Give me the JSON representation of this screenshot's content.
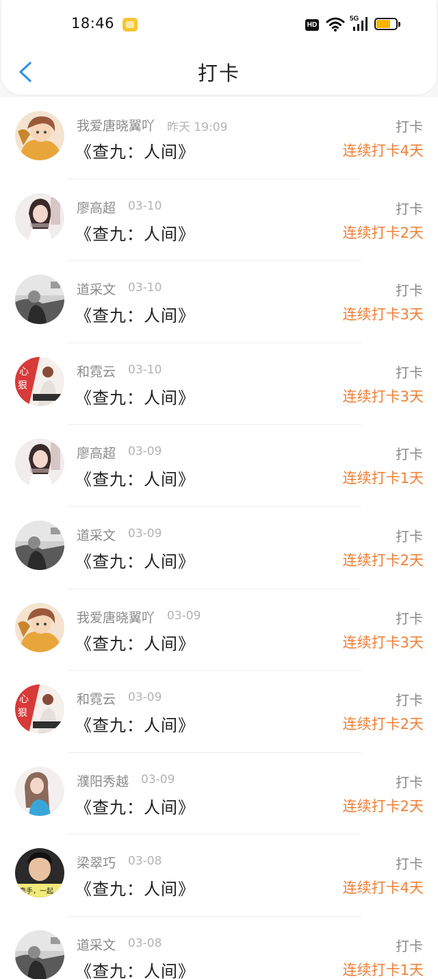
{
  "status_bar": {
    "time": "18:46",
    "hd_label": "HD",
    "network_label": "5G",
    "battery_level": 0.7,
    "battery_color": "#f7b500",
    "icons": [
      "app-notification-icon",
      "wifi-icon",
      "signal-icon",
      "battery-icon"
    ]
  },
  "header": {
    "title": "打卡",
    "back_icon": "chevron-left-icon",
    "back_color": "#2e8fe6"
  },
  "colors": {
    "streak": "#f07f36",
    "secondary_text": "#8a8a8a",
    "date_text": "#b3b3b3"
  },
  "records": [
    {
      "name": "我爱唐晓翼吖",
      "date": "昨天 19:09",
      "book": "《查九：人间》",
      "action": "打卡",
      "streak": "连续打卡4天",
      "avatar": "anime-boy-avatar"
    },
    {
      "name": "廖高超",
      "date": "03-10",
      "book": "《查九：人间》",
      "action": "打卡",
      "streak": "连续打卡2天",
      "avatar": "girl-portrait-avatar"
    },
    {
      "name": "道采文",
      "date": "03-10",
      "book": "《查九：人间》",
      "action": "打卡",
      "streak": "连续打卡3天",
      "avatar": "grayscale-photo-avatar"
    },
    {
      "name": "和霓云",
      "date": "03-10",
      "book": "《查九：人间》",
      "action": "打卡",
      "streak": "连续打卡3天",
      "avatar": "red-poster-avatar"
    },
    {
      "name": "廖高超",
      "date": "03-09",
      "book": "《查九：人间》",
      "action": "打卡",
      "streak": "连续打卡1天",
      "avatar": "girl-portrait-avatar"
    },
    {
      "name": "道采文",
      "date": "03-09",
      "book": "《查九：人间》",
      "action": "打卡",
      "streak": "连续打卡2天",
      "avatar": "grayscale-photo-avatar"
    },
    {
      "name": "我爱唐晓翼吖",
      "date": "03-09",
      "book": "《查九：人间》",
      "action": "打卡",
      "streak": "连续打卡3天",
      "avatar": "anime-boy-avatar"
    },
    {
      "name": "和霓云",
      "date": "03-09",
      "book": "《查九：人间》",
      "action": "打卡",
      "streak": "连续打卡2天",
      "avatar": "red-poster-avatar"
    },
    {
      "name": "濮阳秀越",
      "date": "03-09",
      "book": "《查九：人间》",
      "action": "打卡",
      "streak": "连续打卡2天",
      "avatar": "woman-blue-top-avatar"
    },
    {
      "name": "梁翠巧",
      "date": "03-08",
      "book": "《查九：人间》",
      "action": "打卡",
      "streak": "连续打卡4天",
      "avatar": "boy-yellow-caption-avatar"
    },
    {
      "name": "道采文",
      "date": "03-08",
      "book": "《查九：人间》",
      "action": "打卡",
      "streak": "连续打卡1天",
      "avatar": "grayscale-photo-avatar"
    }
  ]
}
